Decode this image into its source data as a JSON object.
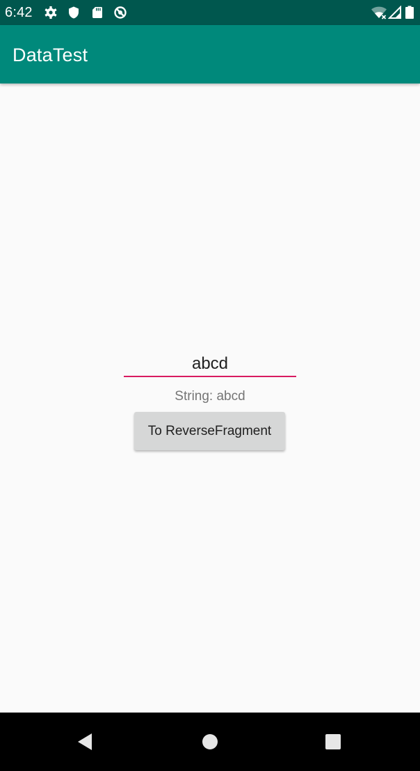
{
  "status_bar": {
    "time": "6:42",
    "left_icons": [
      "gear-icon",
      "shield-icon",
      "sd-card-icon",
      "no-sync-icon"
    ],
    "right_icons": [
      "wifi-off-icon",
      "signal-icon",
      "battery-icon"
    ]
  },
  "app_bar": {
    "title": "DataTest"
  },
  "main": {
    "input_value": "abcd",
    "result_text": "String: abcd",
    "button_label": "To ReverseFragment"
  },
  "nav_bar": {
    "buttons": [
      "back-icon",
      "home-icon",
      "recents-icon"
    ]
  },
  "colors": {
    "status_bar": "#00574e",
    "app_bar": "#00897b",
    "accent": "#d81b60",
    "background": "#fafafa",
    "button": "#d6d7d7"
  }
}
